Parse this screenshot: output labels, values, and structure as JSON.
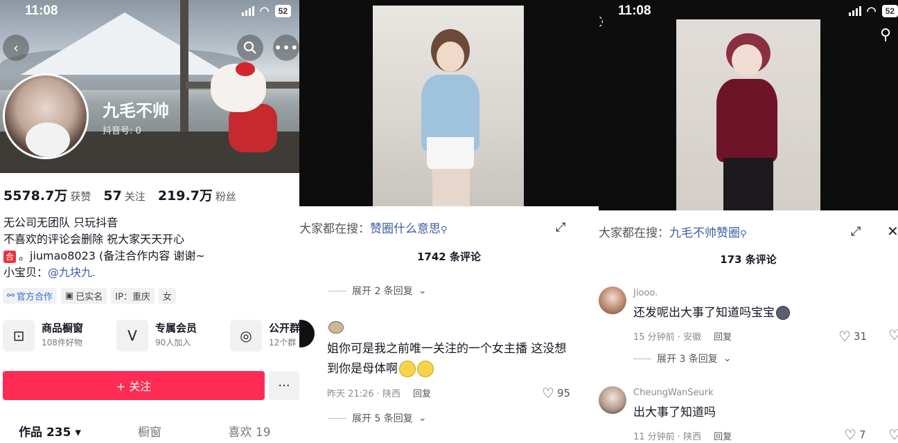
{
  "profile": {
    "status": {
      "time": "11:08",
      "battery": "52"
    },
    "nickname": "九毛不帅",
    "douyin_id": "抖音号: 0",
    "stats": [
      {
        "value": "5578.7万",
        "label": "获赞"
      },
      {
        "value": "57",
        "label": "关注"
      },
      {
        "value": "219.7万",
        "label": "粉丝"
      }
    ],
    "bio": {
      "line1": "无公司无团队 只玩抖音",
      "line2": "不喜欢的评论会删除 祝大家天天开心",
      "line3_badge": "合",
      "line3": "。jiumao8023 (备注合作内容 谢谢~",
      "line4_prefix": "小宝贝：",
      "line4_mention": "@九块九."
    },
    "tags": [
      "官方合作",
      "已实名",
      "IP：重庆",
      "女"
    ],
    "cards": [
      {
        "title": "商品橱窗",
        "sub": "108件好物",
        "icon": "shopping-bag-icon"
      },
      {
        "title": "专属会员",
        "sub": "90人加入",
        "icon": "member-v-icon"
      },
      {
        "title": "公开群",
        "sub": "12个群",
        "icon": "group-chat-icon"
      }
    ],
    "follow_label": "+ 关注",
    "more_label": "···",
    "tabs": [
      {
        "label": "作品 235 ▾"
      },
      {
        "label": "橱窗"
      },
      {
        "label": "喜欢 19"
      }
    ]
  },
  "video2": {
    "search_prefix": "大家都在搜：",
    "search_term": "赞圈什么意思",
    "comment_count": "1742 条评论",
    "expand_top": "展开 2 条回复",
    "comment": {
      "text_line1": "姐你可是我之前唯一关注的一个女主播 这没想",
      "text_line2": "到你是母体啊",
      "time": "昨天 21:26 · 陕西",
      "reply": "回复",
      "likes": "95"
    },
    "expand_bottom": "展开 5 条回复"
  },
  "video3": {
    "status": {
      "time": "11:08",
      "battery": "52"
    },
    "search_prefix": "大家都在搜：",
    "search_term": "九毛不帅赞圈",
    "comment_count": "173 条评论",
    "comments": [
      {
        "user": "Jiooo.",
        "text": "还发呢出大事了知道吗宝宝",
        "time": "15 分钟前 · 安徽",
        "reply": "回复",
        "likes": "31"
      },
      {
        "user": "CheungWanSeurk",
        "text": "出大事了知道吗",
        "time": "11 分钟前 · 陕西",
        "reply": "回复",
        "likes": "7"
      }
    ],
    "expand": "展开 3 条回复"
  },
  "colors": {
    "accent": "#fe2c55",
    "link": "#3b5ea6",
    "video_bg": "#0d0d0d"
  }
}
